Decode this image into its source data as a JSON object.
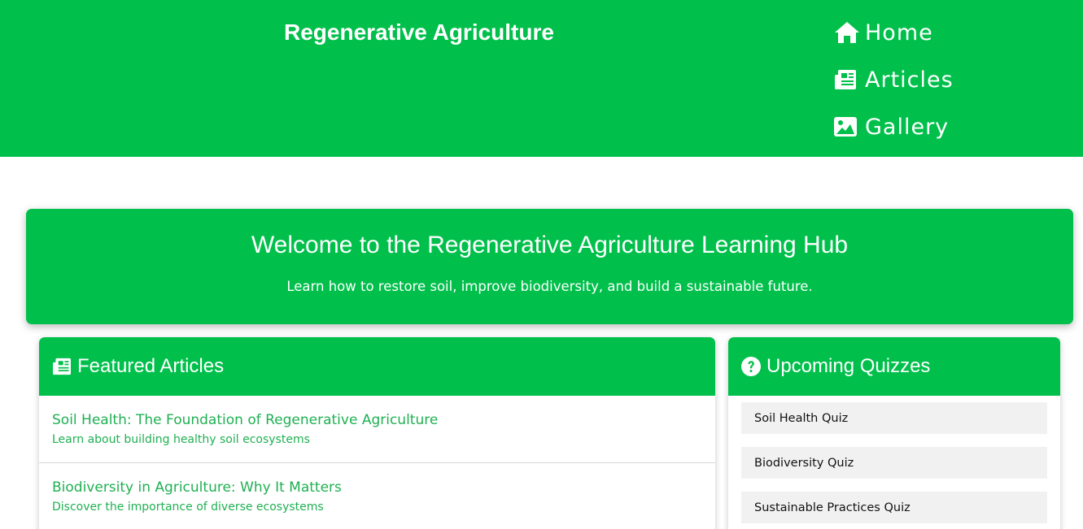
{
  "header": {
    "site_title": "Regenerative Agriculture",
    "nav": [
      {
        "label": "Home",
        "icon": "home-icon"
      },
      {
        "label": "Articles",
        "icon": "newspaper-icon"
      },
      {
        "label": "Gallery",
        "icon": "image-icon"
      }
    ]
  },
  "hero": {
    "title": "Welcome to the Regenerative Agriculture Learning Hub",
    "subtitle": "Learn how to restore soil, improve biodiversity, and build a sustainable future."
  },
  "featured": {
    "heading": "Featured Articles",
    "icon": "newspaper-icon",
    "articles": [
      {
        "title": "Soil Health: The Foundation of Regenerative Agriculture",
        "desc": "Learn about building healthy soil ecosystems"
      },
      {
        "title": "Biodiversity in Agriculture: Why It Matters",
        "desc": "Discover the importance of diverse ecosystems"
      }
    ]
  },
  "quizzes": {
    "heading": "Upcoming Quizzes",
    "icon": "question-circle-icon",
    "items": [
      "Soil Health Quiz",
      "Biodiversity Quiz",
      "Sustainable Practices Quiz"
    ]
  },
  "colors": {
    "brand_green": "#00c04b",
    "link_green": "#1fb052",
    "quiz_bg": "#f1f1f1"
  }
}
